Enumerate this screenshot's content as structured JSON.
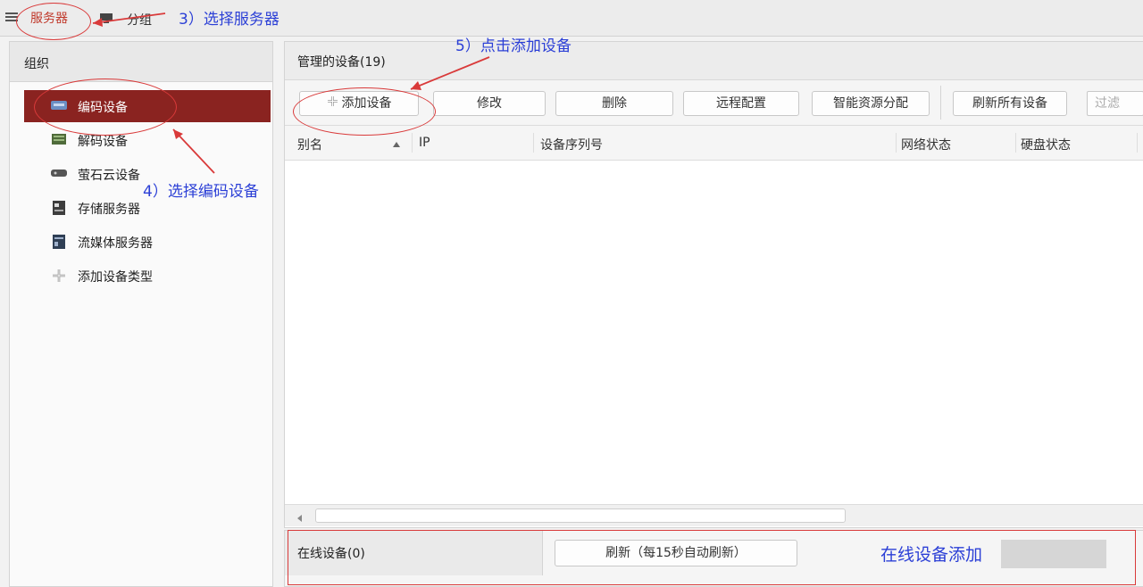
{
  "top_tabs": [
    {
      "label": "服务器",
      "icon": "server-icon",
      "active": true
    },
    {
      "label": "分组",
      "icon": "group-icon",
      "active": false
    }
  ],
  "sidebar": {
    "title": "组织",
    "items": [
      {
        "label": "编码设备",
        "icon": "encoder-icon",
        "active": true
      },
      {
        "label": "解码设备",
        "icon": "decoder-icon",
        "active": false
      },
      {
        "label": "萤石云设备",
        "icon": "cloud-device-icon",
        "active": false
      },
      {
        "label": "存储服务器",
        "icon": "storage-server-icon",
        "active": false
      },
      {
        "label": "流媒体服务器",
        "icon": "stream-server-icon",
        "active": false
      },
      {
        "label": "添加设备类型",
        "icon": "add-type-icon",
        "active": false
      }
    ]
  },
  "main": {
    "title": "管理的设备(19)",
    "toolbar": {
      "add": "添加设备",
      "modify": "修改",
      "delete": "删除",
      "remote_config": "远程配置",
      "smart_alloc": "智能资源分配",
      "refresh_all": "刷新所有设备",
      "filter_placeholder": "过滤"
    },
    "columns": [
      "别名",
      "IP",
      "设备序列号",
      "网络状态",
      "硬盘状态"
    ],
    "rows": []
  },
  "online": {
    "title": "在线设备(0)",
    "refresh": "刷新（每15秒自动刷新）"
  },
  "annotations": {
    "step3": "3）选择服务器",
    "step4": "4）选择编码设备",
    "step5": "5）点击添加设备",
    "online_add": "在线设备添加"
  },
  "colors": {
    "active_item": "#8a2320",
    "annotation_text": "#2b3fd6",
    "annotation_mark": "#d93a3a"
  }
}
